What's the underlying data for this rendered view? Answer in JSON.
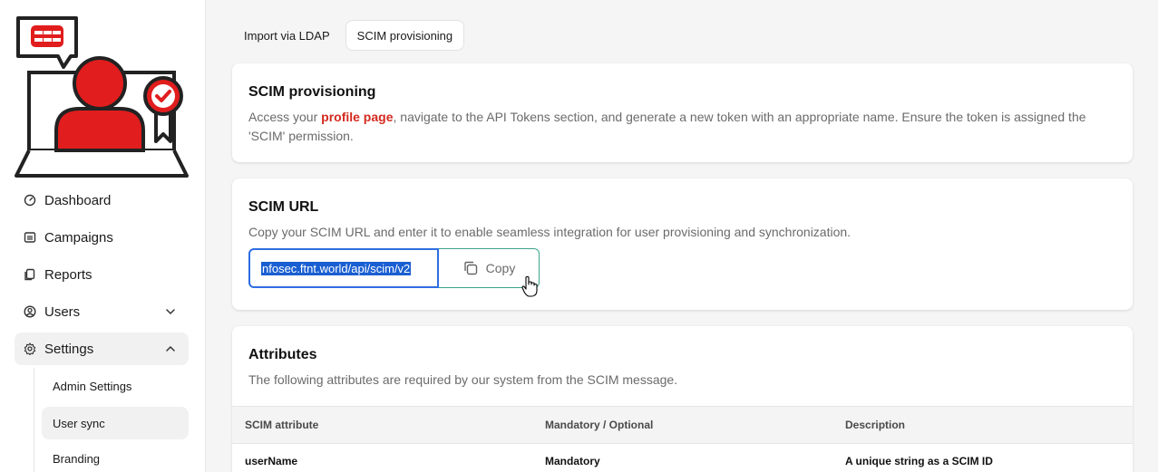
{
  "sidebar": {
    "items": [
      {
        "label": "Dashboard",
        "icon": "dashboard-gauge-icon"
      },
      {
        "label": "Campaigns",
        "icon": "campaigns-icon"
      },
      {
        "label": "Reports",
        "icon": "reports-icon"
      },
      {
        "label": "Users",
        "icon": "user-circle-icon"
      },
      {
        "label": "Settings",
        "icon": "gear-icon"
      }
    ],
    "sub_items": [
      "Admin Settings",
      "User sync",
      "Branding"
    ]
  },
  "tabs": [
    "Import via LDAP",
    "SCIM provisioning"
  ],
  "provisioning": {
    "title": "SCIM provisioning",
    "desc_before": "Access your ",
    "desc_link": "profile page",
    "desc_after": ", navigate to the API Tokens section, and generate a new token with an appropriate name. Ensure the token is assigned the 'SCIM' permission."
  },
  "scim_url": {
    "title": "SCIM URL",
    "desc": "Copy your SCIM URL and enter it to enable seamless integration for user provisioning and synchronization.",
    "value": "nfosec.ftnt.world/api/scim/v2",
    "copy_label": "Copy"
  },
  "attributes": {
    "title": "Attributes",
    "desc": "The following attributes are required by our system from the SCIM message.",
    "columns": [
      "SCIM attribute",
      "Mandatory / Optional",
      "Description"
    ],
    "rows": [
      [
        "userName",
        "Mandatory",
        "A unique string as a SCIM ID"
      ]
    ]
  },
  "colors": {
    "accent": "#d42a1f",
    "selection": "#1a5fd1",
    "copy_border": "#3ca38a"
  }
}
